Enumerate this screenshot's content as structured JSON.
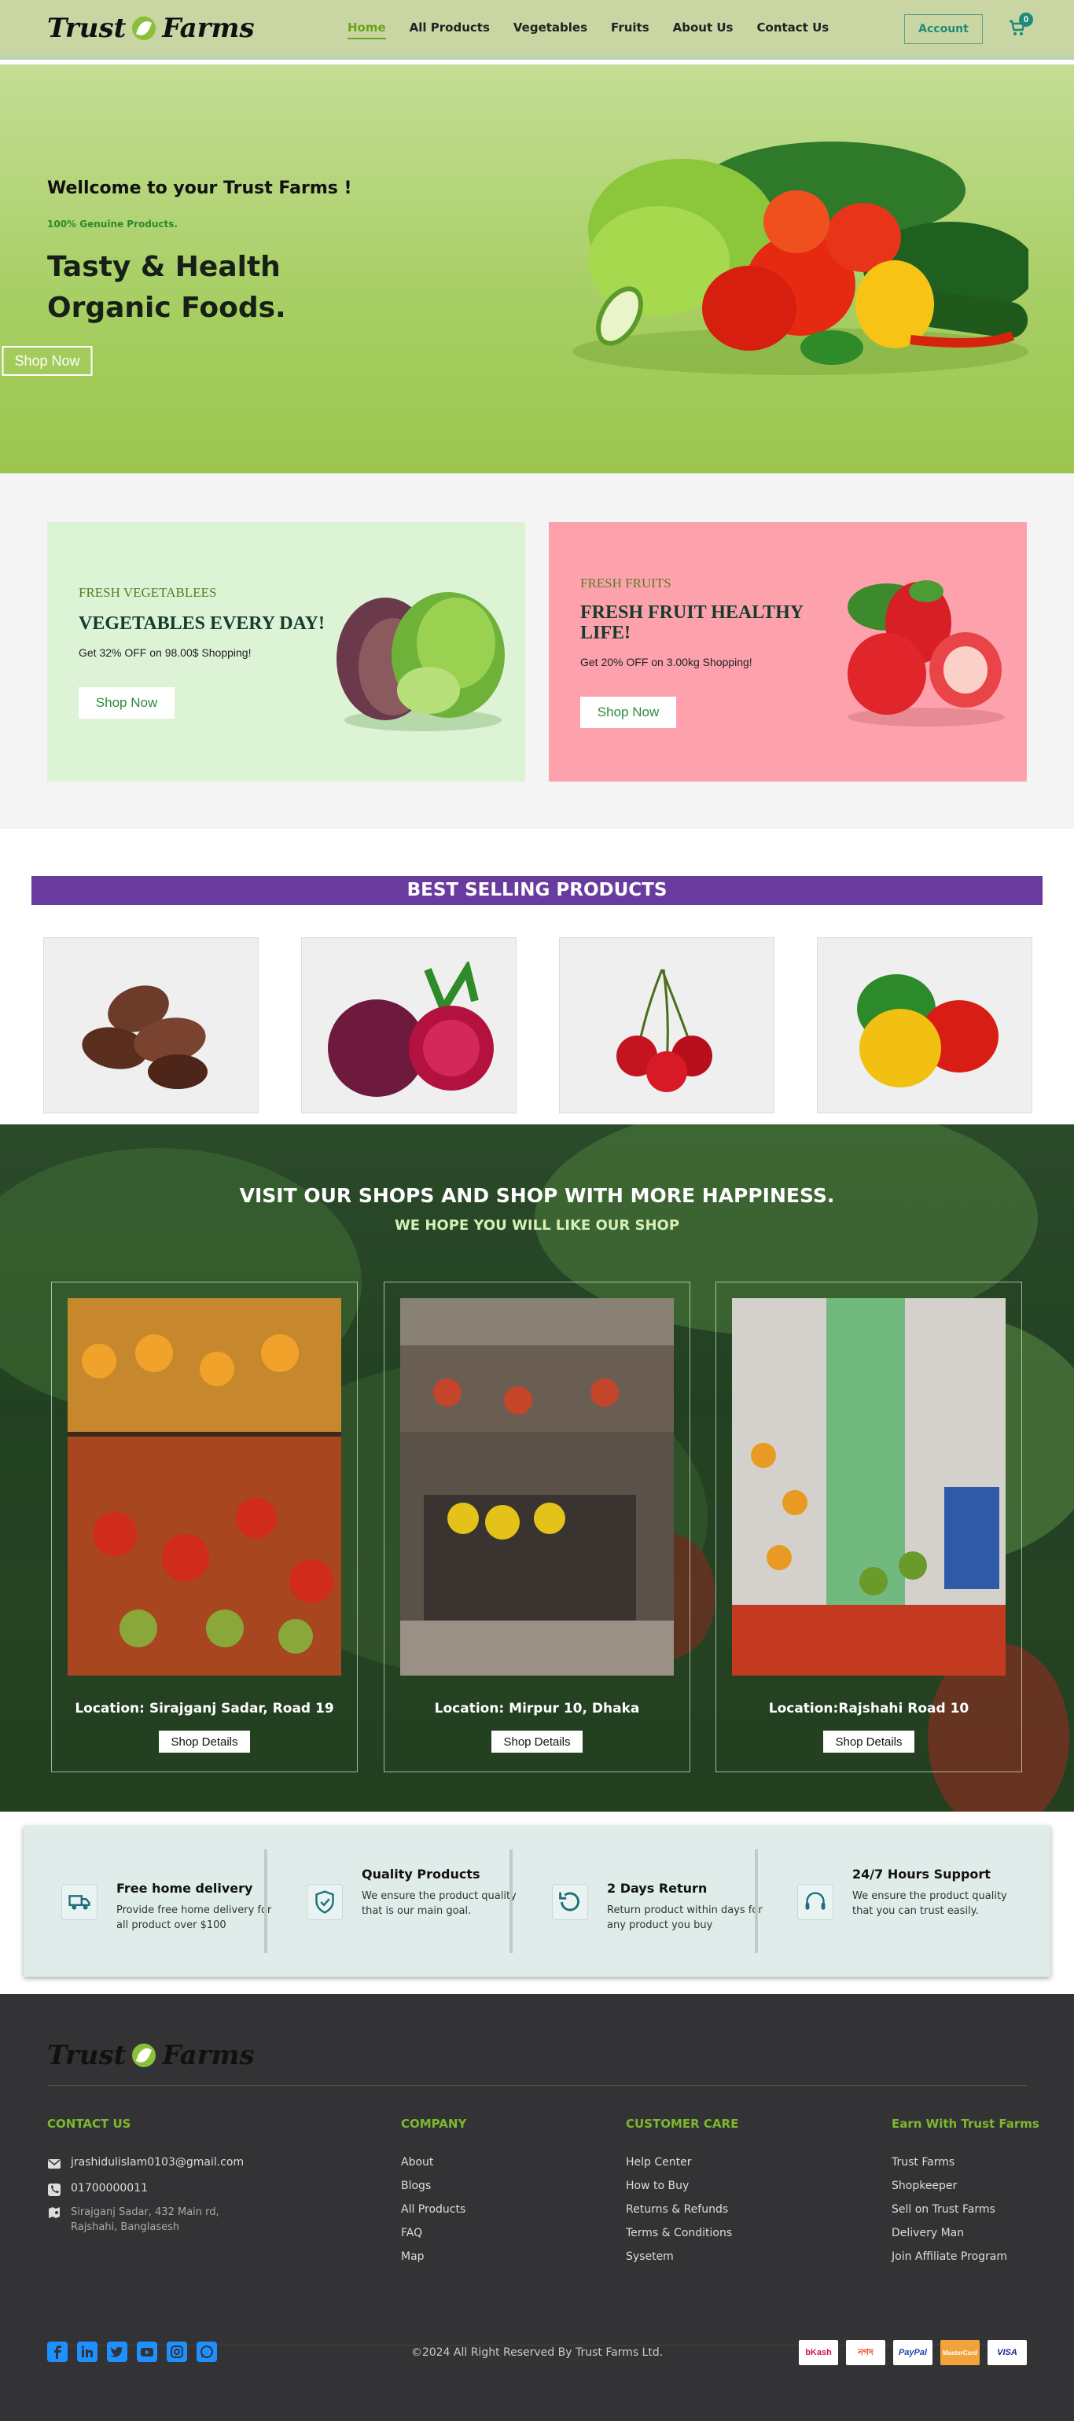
{
  "header": {
    "logo_left": "Trust",
    "logo_right": "Farms",
    "nav": [
      {
        "label": "Home",
        "active": true
      },
      {
        "label": "All Products"
      },
      {
        "label": "Vegetables"
      },
      {
        "label": "Fruits"
      },
      {
        "label": "About Us"
      },
      {
        "label": "Contact Us"
      }
    ],
    "account_label": "Account",
    "cart_count": "0",
    "cart_icon": "cart-icon"
  },
  "hero": {
    "welcome": "Wellcome to your Trust Farms !",
    "genuine": "100% Genuine Products.",
    "headline": "Tasty & Health Organic Foods.",
    "button": "Shop Now"
  },
  "promos": [
    {
      "tag": "FRESH VEGETABLEES",
      "title": "VEGETABLES EVERY DAY!",
      "offer": "Get 32% OFF on 98.00$ Shopping!",
      "button": "Shop Now"
    },
    {
      "tag": "FRESH FRUITS",
      "title": "FRESH FRUIT HEALTHY LIFE!",
      "offer": "Get 20% OFF on 3.00kg Shopping!",
      "button": "Shop Now"
    }
  ],
  "best_selling": {
    "title": "BEST SELLING PRODUCTS",
    "products": [
      "dates",
      "beetroot",
      "cherries",
      "bell-peppers"
    ]
  },
  "shops": {
    "title": "VISIT OUR SHOPS AND SHOP WITH MORE HAPPINESS.",
    "subtitle": "WE HOPE YOU WILL LIKE OUR SHOP",
    "items": [
      {
        "location": "Location: Sirajganj Sadar, Road 19",
        "button": "Shop Details"
      },
      {
        "location": "Location: Mirpur 10, Dhaka",
        "button": "Shop Details"
      },
      {
        "location": "Location:Rajshahi Road 10",
        "button": "Shop Details"
      }
    ]
  },
  "features": [
    {
      "icon": "truck-icon",
      "title": "Free home delivery",
      "desc": "Provide free home delivery for all product over $100"
    },
    {
      "icon": "shield-check-icon",
      "title": "Quality Products",
      "desc": "We ensure the product quality that is our main goal."
    },
    {
      "icon": "return-icon",
      "title": "2 Days Return",
      "desc": "Return product within days for any product you buy"
    },
    {
      "icon": "headset-icon",
      "title": "24/7 Hours Support",
      "desc": "We ensure the product quality that you can trust easily."
    }
  ],
  "footer": {
    "logo_left": "Trust",
    "logo_right": "Farms",
    "contact_title": "CONTACT US",
    "email": "jrashidulislam0103@gmail.com",
    "phone": "01700000011",
    "address": "Sirajganj Sadar, 432 Main rd, Rajshahi, Banglasesh",
    "company_title": "COMPANY",
    "company": [
      "About",
      "Blogs",
      "All Products",
      "FAQ",
      "Map"
    ],
    "care_title": "CUSTOMER CARE",
    "care": [
      "Help Center",
      "How to Buy",
      "Returns & Refunds",
      "Terms & Conditions",
      "Sysetem"
    ],
    "earn_title": "Earn With Trust Farms",
    "earn": [
      "Trust Farms",
      "Shopkeeper",
      "Sell on Trust Farms",
      "Delivery Man",
      "Join Affiliate Program"
    ],
    "copyright": "©2024 All Right Reserved By Trust Farms Ltd.",
    "social": [
      "facebook-icon",
      "linkedin-icon",
      "twitter-icon",
      "youtube-icon",
      "instagram-icon",
      "whatsapp-icon"
    ],
    "payments": [
      "bKash",
      "নগদ",
      "PayPal",
      "MasterCard",
      "VISA"
    ]
  },
  "colors": {
    "accent": "#6aa319",
    "brand_green": "#8bbf3a",
    "teal": "#1f8a78",
    "purple": "#6a3b9e",
    "footer_bg": "#333335"
  }
}
